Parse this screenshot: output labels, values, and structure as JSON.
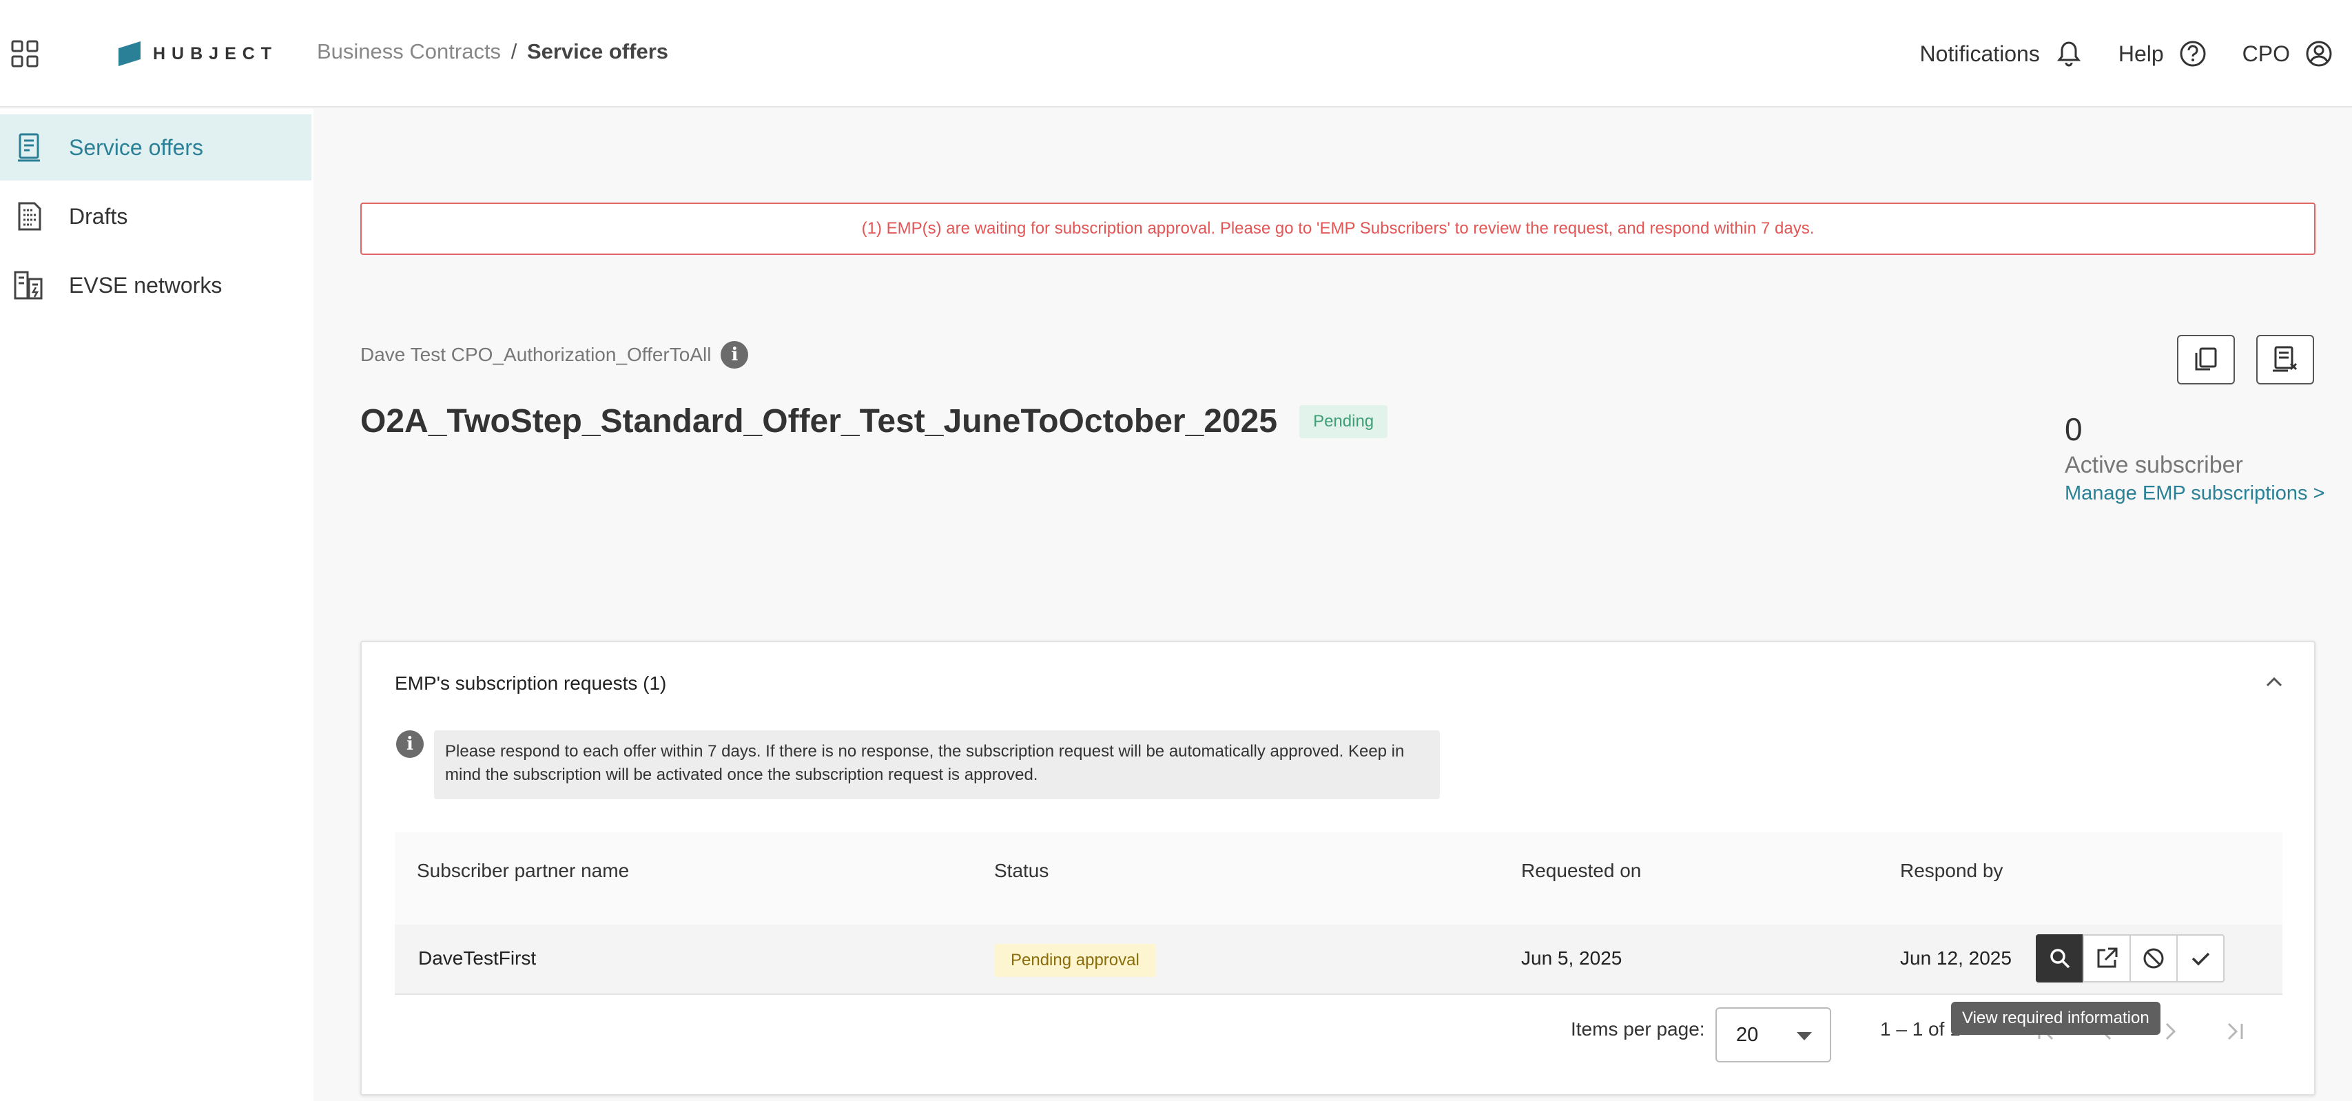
{
  "header": {
    "logo_text": "HUBJECT",
    "breadcrumb": {
      "parent": "Business Contracts",
      "separator": "/",
      "current": "Service offers"
    },
    "notifications_label": "Notifications",
    "help_label": "Help",
    "user_label": "CPO"
  },
  "sidebar": {
    "items": [
      {
        "label": "Service offers",
        "active": true
      },
      {
        "label": "Drafts",
        "active": false
      },
      {
        "label": "EVSE networks",
        "active": false
      }
    ]
  },
  "alert": {
    "text": "(1) EMP(s) are waiting for subscription approval. Please go to 'EMP Subscribers' to review the request, and respond within 7 days.",
    "color": "#e25656"
  },
  "offer": {
    "owner": "Dave Test CPO_Authorization_OfferToAll",
    "title": "O2A_TwoStep_Standard_Offer_Test_JuneToOctober_2025",
    "status": "Pending"
  },
  "stats": {
    "active_subscribers": "0",
    "active_label": "Active subscriber",
    "manage_link": "Manage EMP subscriptions >"
  },
  "subscriptions": {
    "title": "EMP's subscription requests (1)",
    "note": "Please respond to each offer within 7 days. If there is no response, the subscription request will be automatically approved. Keep in mind the subscription will be activated once the subscription request is approved.",
    "columns": [
      "Subscriber partner name",
      "Status",
      "Requested on",
      "Respond by"
    ],
    "rows": [
      {
        "partner": "DaveTestFirst",
        "status": "Pending approval",
        "requested_on": "Jun 5, 2025",
        "respond_by": "Jun 12, 2025"
      }
    ],
    "tooltip": "View required information",
    "paginator": {
      "items_per_page_label": "Items per page:",
      "items_per_page": "20",
      "range": "1 – 1 of 1"
    }
  },
  "colors": {
    "accent": "#2a8197",
    "active_bg": "#e1f0f0",
    "pending_badge": "#3f9e79",
    "status_chip": "#fdf4d0"
  }
}
